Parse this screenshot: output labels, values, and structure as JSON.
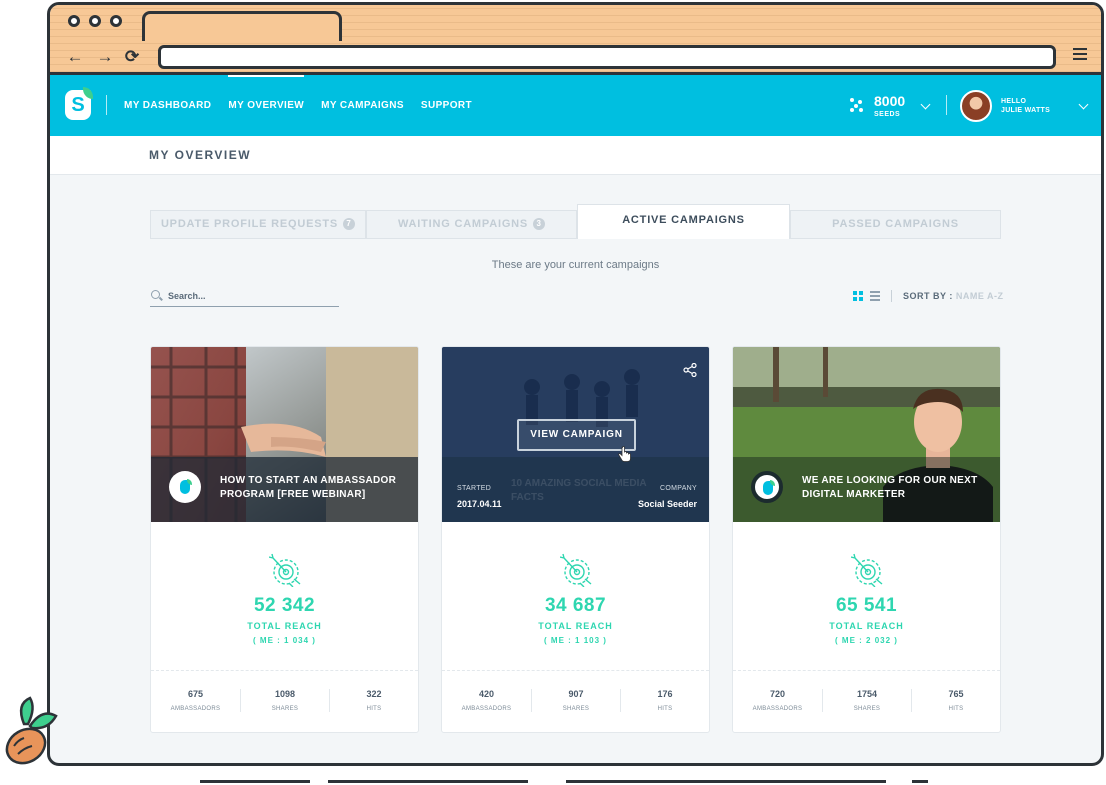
{
  "browser": {
    "back": "←",
    "forward": "→",
    "reload": "⟳",
    "url": ""
  },
  "header": {
    "logo": "S",
    "nav": [
      {
        "label": "MY DASHBOARD",
        "active": false
      },
      {
        "label": "MY OVERVIEW",
        "active": true
      },
      {
        "label": "MY CAMPAIGNS",
        "active": false
      },
      {
        "label": "SUPPORT",
        "active": false
      }
    ],
    "seeds": {
      "count": "8000",
      "label": "SEEDS"
    },
    "user": {
      "hello": "HELLO",
      "name": "JULIE WATTS"
    }
  },
  "page": {
    "title": "MY OVERVIEW",
    "subtitle": "These are your current campaigns"
  },
  "tabs": [
    {
      "label": "UPDATE PROFILE REQUESTS",
      "badge": "7",
      "active": false
    },
    {
      "label": "WAITING CAMPAIGNS",
      "badge": "3",
      "active": false
    },
    {
      "label": "ACTIVE CAMPAIGNS",
      "badge": "",
      "active": true
    },
    {
      "label": "PASSED CAMPAIGNS",
      "badge": "",
      "active": false
    }
  ],
  "search": {
    "placeholder": "Search..."
  },
  "sort": {
    "label": "SORT BY :",
    "value": "NAME A-Z"
  },
  "colors": {
    "primary": "#00bfe0",
    "accent": "#2ed6b0",
    "overlay": "#142c52",
    "text": "#4a5a6a"
  },
  "cards": [
    {
      "title": "HOW TO START AN AMBASSADOR PROGRAM [FREE WEBINAR]",
      "reach": "52 342",
      "reach_label": "TOTAL REACH",
      "me": "( ME : 1 034 )",
      "stats": [
        {
          "value": "675",
          "label": "AMBASSADORS"
        },
        {
          "value": "1098",
          "label": "SHARES"
        },
        {
          "value": "322",
          "label": "HITS"
        }
      ]
    },
    {
      "title": "10 AMAZING SOCIAL MEDIA FACTS",
      "view_label": "VIEW CAMPAIGN",
      "started_label": "STARTED",
      "started_value": "2017.04.11",
      "company_label": "COMPANY",
      "company_value": "Social Seeder",
      "reach": "34 687",
      "reach_label": "TOTAL REACH",
      "me": "( ME : 1 103 )",
      "stats": [
        {
          "value": "420",
          "label": "AMBASSADORS"
        },
        {
          "value": "907",
          "label": "SHARES"
        },
        {
          "value": "176",
          "label": "HITS"
        }
      ]
    },
    {
      "title": "WE ARE LOOKING FOR OUR NEXT DIGITAL MARKETER",
      "reach": "65 541",
      "reach_label": "TOTAL REACH",
      "me": "( ME : 2 032 )",
      "stats": [
        {
          "value": "720",
          "label": "AMBASSADORS"
        },
        {
          "value": "1754",
          "label": "SHARES"
        },
        {
          "value": "765",
          "label": "HITS"
        }
      ]
    }
  ]
}
